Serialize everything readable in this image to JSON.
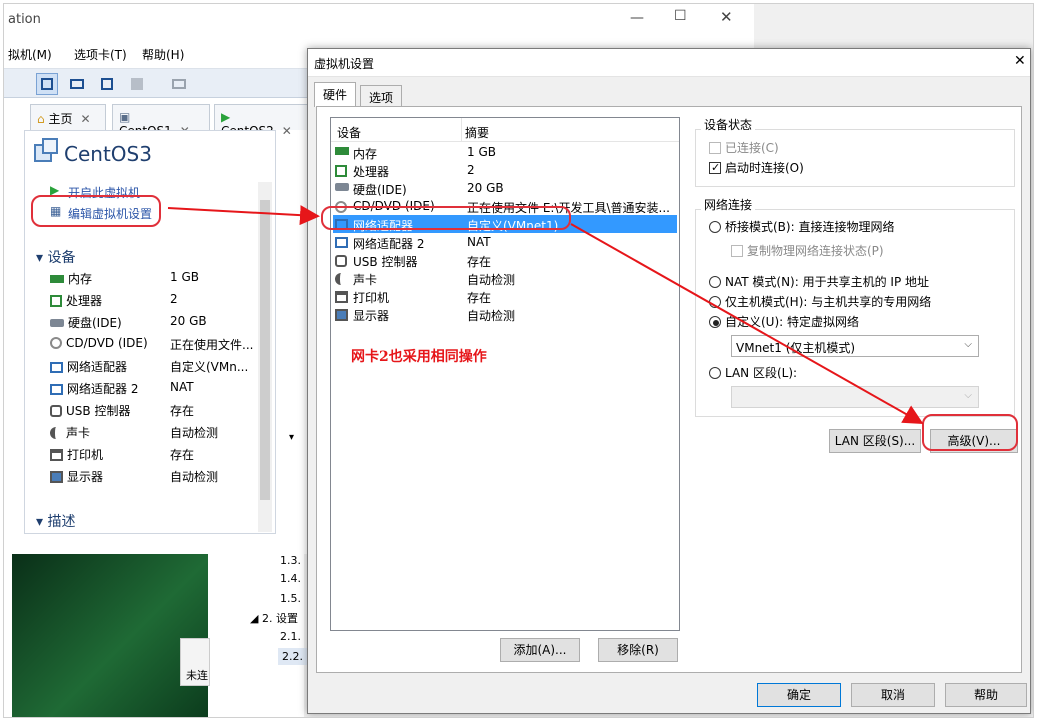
{
  "background_window": {
    "title": "ation",
    "menu": [
      "拟机(M)",
      "选项卡(T)",
      "帮助(H)"
    ],
    "tabs": [
      {
        "label": "主页"
      },
      {
        "label": "CentOS1"
      },
      {
        "label": "CentOS2"
      }
    ],
    "vm_title": "CentOS3",
    "actions": {
      "power_on": "开启此虚拟机",
      "edit_settings": "编辑虚拟机设置"
    },
    "devices_heading": "设备",
    "devices": [
      {
        "name": "内存",
        "value": "1 GB",
        "icon": "memory-icon"
      },
      {
        "name": "处理器",
        "value": "2",
        "icon": "cpu-icon"
      },
      {
        "name": "硬盘(IDE)",
        "value": "20 GB",
        "icon": "disk-icon"
      },
      {
        "name": "CD/DVD (IDE)",
        "value": "正在使用文件...",
        "icon": "cd-icon"
      },
      {
        "name": "网络适配器",
        "value": "自定义(VMn...",
        "icon": "network-icon"
      },
      {
        "name": "网络适配器 2",
        "value": "NAT",
        "icon": "network-icon"
      },
      {
        "name": "USB 控制器",
        "value": "存在",
        "icon": "usb-icon"
      },
      {
        "name": "声卡",
        "value": "自动检测",
        "icon": "sound-icon"
      },
      {
        "name": "打印机",
        "value": "存在",
        "icon": "printer-icon"
      },
      {
        "name": "显示器",
        "value": "自动检测",
        "icon": "display-icon"
      }
    ],
    "description_heading": "描述",
    "outline": [
      "1.3.",
      "1.4.",
      "1.5.",
      "2. 设置",
      "2.1.",
      "2.2."
    ],
    "status_text": "未连"
  },
  "dialog": {
    "title": "虚拟机设置",
    "tabs": [
      "硬件",
      "选项"
    ],
    "list_headers": {
      "device": "设备",
      "summary": "摘要"
    },
    "devices": [
      {
        "name": "内存",
        "summary": "1 GB",
        "icon": "memory-icon"
      },
      {
        "name": "处理器",
        "summary": "2",
        "icon": "cpu-icon"
      },
      {
        "name": "硬盘(IDE)",
        "summary": "20 GB",
        "icon": "disk-icon"
      },
      {
        "name": "CD/DVD (IDE)",
        "summary": "正在使用文件 E:\\开发工具\\普通安装...",
        "icon": "cd-icon"
      },
      {
        "name": "网络适配器",
        "summary": "自定义(VMnet1)",
        "icon": "network-icon",
        "selected": true
      },
      {
        "name": "网络适配器 2",
        "summary": "NAT",
        "icon": "network-icon"
      },
      {
        "name": "USB 控制器",
        "summary": "存在",
        "icon": "usb-icon"
      },
      {
        "name": "声卡",
        "summary": "自动检测",
        "icon": "sound-icon"
      },
      {
        "name": "打印机",
        "summary": "存在",
        "icon": "printer-icon"
      },
      {
        "name": "显示器",
        "summary": "自动检测",
        "icon": "display-icon"
      }
    ],
    "add_button": "添加(A)...",
    "remove_button": "移除(R)",
    "device_status": {
      "heading": "设备状态",
      "connected": {
        "label": "已连接(C)",
        "checked": false,
        "enabled": false
      },
      "connect_at_power_on": {
        "label": "启动时连接(O)",
        "checked": true
      }
    },
    "network": {
      "heading": "网络连接",
      "bridged": "桥接模式(B): 直接连接物理网络",
      "replicate": "复制物理网络连接状态(P)",
      "nat": "NAT 模式(N): 用于共享主机的 IP 地址",
      "host_only": "仅主机模式(H): 与主机共享的专用网络",
      "custom": "自定义(U): 特定虚拟网络",
      "selected": "custom",
      "custom_select_value": "VMnet1 (仅主机模式)",
      "lan_segment": "LAN 区段(L):",
      "lan_segment_value": ""
    },
    "lan_segments_button": "LAN 区段(S)...",
    "advanced_button": "高级(V)...",
    "ok_button": "确定",
    "cancel_button": "取消",
    "help_button": "帮助"
  },
  "annotation": {
    "text": "网卡2也采用相同操作",
    "color": "#e6161a"
  }
}
